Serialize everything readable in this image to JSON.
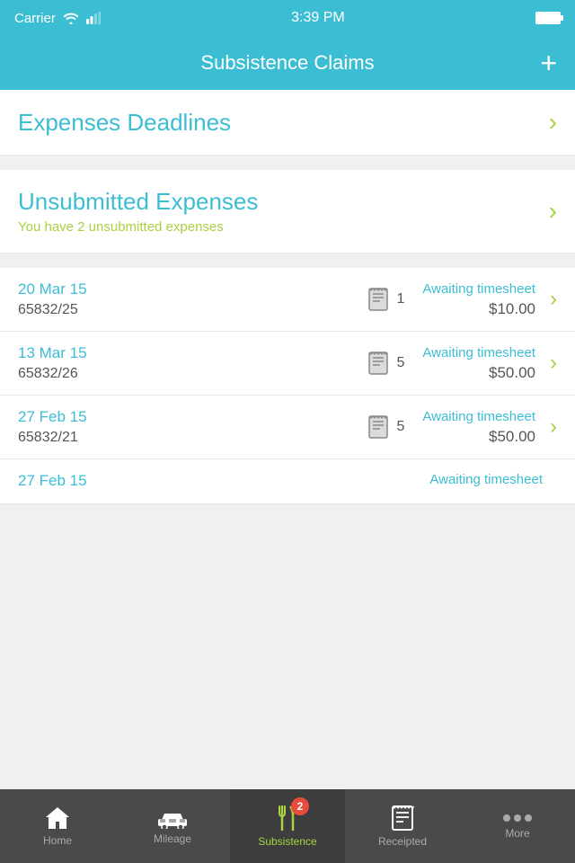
{
  "statusBar": {
    "carrier": "Carrier",
    "time": "3:39 PM"
  },
  "header": {
    "title": "Subsistence Claims",
    "addButton": "+"
  },
  "sections": {
    "deadlines": {
      "title": "Expenses Deadlines"
    },
    "unsubmitted": {
      "title": "Unsubmitted Expenses",
      "subtitle": "You have 2 unsubmitted expenses"
    }
  },
  "listItems": [
    {
      "date": "20 Mar 15",
      "id": "65832/25",
      "count": "1",
      "status": "Awaiting timesheet",
      "amount": "$10.00"
    },
    {
      "date": "13 Mar 15",
      "id": "65832/26",
      "count": "5",
      "status": "Awaiting timesheet",
      "amount": "$50.00"
    },
    {
      "date": "27 Feb 15",
      "id": "65832/21",
      "count": "5",
      "status": "Awaiting timesheet",
      "amount": "$50.00"
    },
    {
      "date": "27 Feb 15",
      "id": "",
      "count": "",
      "status": "Awaiting timesheet",
      "amount": ""
    }
  ],
  "tabBar": {
    "items": [
      {
        "label": "Home",
        "icon": "home",
        "active": false
      },
      {
        "label": "Mileage",
        "icon": "car",
        "active": false
      },
      {
        "label": "Subsistence",
        "icon": "fork-knife",
        "active": true,
        "badge": "2"
      },
      {
        "label": "Receipted",
        "icon": "receipt",
        "active": false
      },
      {
        "label": "More",
        "icon": "more-dots",
        "active": false
      }
    ]
  }
}
